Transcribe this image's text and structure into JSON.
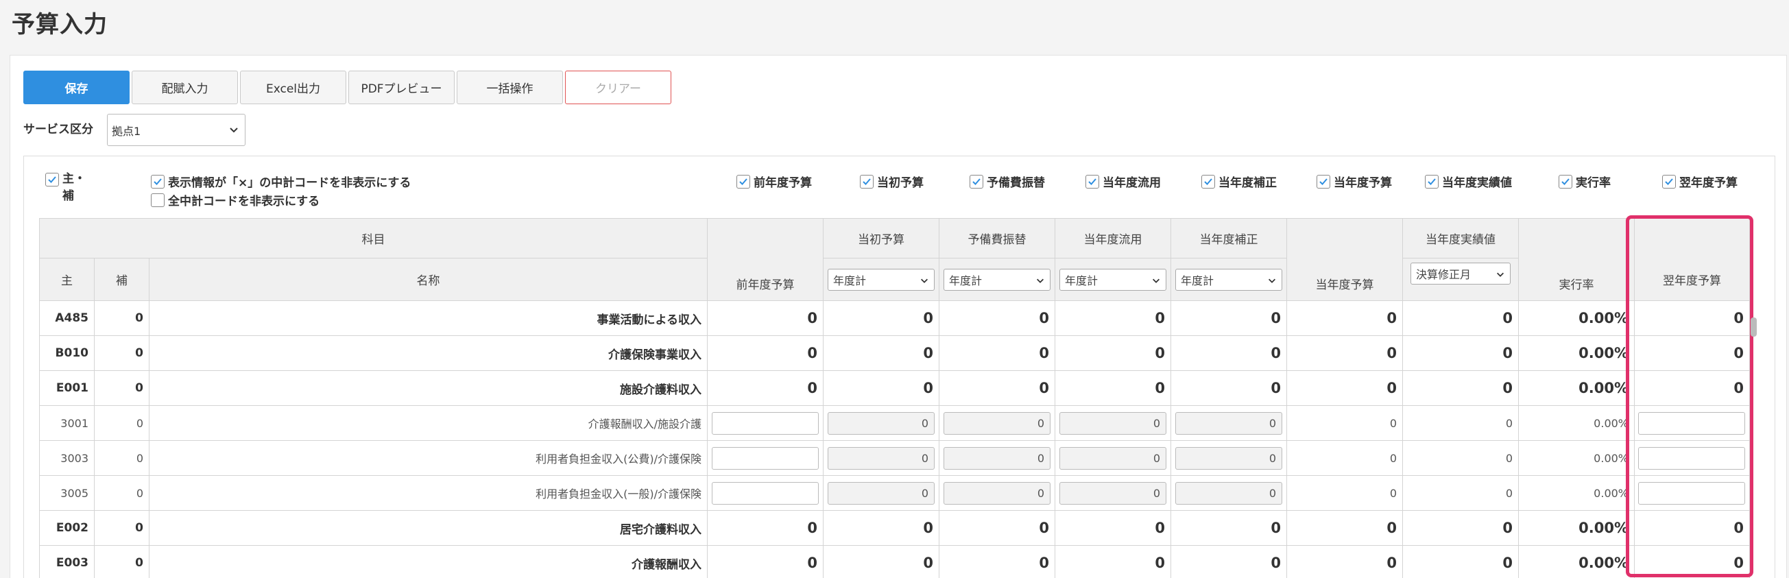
{
  "page": {
    "title": "予算入力"
  },
  "toolbar": {
    "save": "保存",
    "distribute": "配賦入力",
    "excel": "Excel出力",
    "pdf": "PDFプレビュー",
    "bulk": "一括操作",
    "clear": "クリアー"
  },
  "service": {
    "label": "サービス区分",
    "value": "拠点1"
  },
  "options": {
    "main_sub": "主・\n補",
    "hide_x": "表示情報が「×」の中計コードを非表示にする",
    "hide_all": "全中計コードを非表示にする",
    "cols": [
      "前年度予算",
      "当初予算",
      "予備費振替",
      "当年度流用",
      "当年度補正",
      "当年度予算",
      "当年度実績値",
      "実行率",
      "翌年度予算"
    ]
  },
  "table": {
    "head": {
      "kamoku": "科目",
      "main": "主",
      "sub": "補",
      "name": "名称",
      "prev": "前年度予算",
      "initial": "当初予算",
      "reserve": "予備費振替",
      "diversion": "当年度流用",
      "supplement": "当年度補正",
      "current": "当年度予算",
      "actual": "当年度実績値",
      "rate": "実行率",
      "next": "翌年度予算"
    },
    "period": {
      "initial": "年度計",
      "reserve": "年度計",
      "diversion": "年度計",
      "supplement": "年度計",
      "actual": "決算修正月"
    },
    "rows": [
      {
        "code": "A485",
        "sub": "0",
        "name": "事業活動による収入",
        "prev": "0",
        "initial": "0",
        "reserve": "0",
        "diversion": "0",
        "supplement": "0",
        "current": "0",
        "actual": "0",
        "rate": "0.00%",
        "next": "0"
      },
      {
        "code": "B010",
        "sub": "0",
        "name": "介護保険事業収入",
        "prev": "0",
        "initial": "0",
        "reserve": "0",
        "diversion": "0",
        "supplement": "0",
        "current": "0",
        "actual": "0",
        "rate": "0.00%",
        "next": "0"
      },
      {
        "code": "E001",
        "sub": "0",
        "name": "施設介護料収入",
        "prev": "0",
        "initial": "0",
        "reserve": "0",
        "diversion": "0",
        "supplement": "0",
        "current": "0",
        "actual": "0",
        "rate": "0.00%",
        "next": "0"
      },
      {
        "code": "3001",
        "sub": "0",
        "name": "介護報酬収入/施設介護",
        "prev": "",
        "initial": "0",
        "reserve": "0",
        "diversion": "0",
        "supplement": "0",
        "current": "0",
        "actual": "0",
        "rate": "0.00%",
        "next": ""
      },
      {
        "code": "3003",
        "sub": "0",
        "name": "利用者負担金収入(公費)/介護保険",
        "prev": "",
        "initial": "0",
        "reserve": "0",
        "diversion": "0",
        "supplement": "0",
        "current": "0",
        "actual": "0",
        "rate": "0.00%",
        "next": ""
      },
      {
        "code": "3005",
        "sub": "0",
        "name": "利用者負担金収入(一般)/介護保険",
        "prev": "",
        "initial": "0",
        "reserve": "0",
        "diversion": "0",
        "supplement": "0",
        "current": "0",
        "actual": "0",
        "rate": "0.00%",
        "next": ""
      },
      {
        "code": "E002",
        "sub": "0",
        "name": "居宅介護料収入",
        "prev": "0",
        "initial": "0",
        "reserve": "0",
        "diversion": "0",
        "supplement": "0",
        "current": "0",
        "actual": "0",
        "rate": "0.00%",
        "next": "0"
      },
      {
        "code": "E003",
        "sub": "0",
        "name": "介護報酬収入",
        "prev": "0",
        "initial": "0",
        "reserve": "0",
        "diversion": "0",
        "supplement": "0",
        "current": "0",
        "actual": "0",
        "rate": "0.00%",
        "next": "0"
      }
    ]
  },
  "colors": {
    "primary": "#2f8fe0",
    "highlight": "#e0306a",
    "danger": "#e05252"
  },
  "icons": {
    "check": "check-icon",
    "dropdown": "chevron-down-icon"
  }
}
